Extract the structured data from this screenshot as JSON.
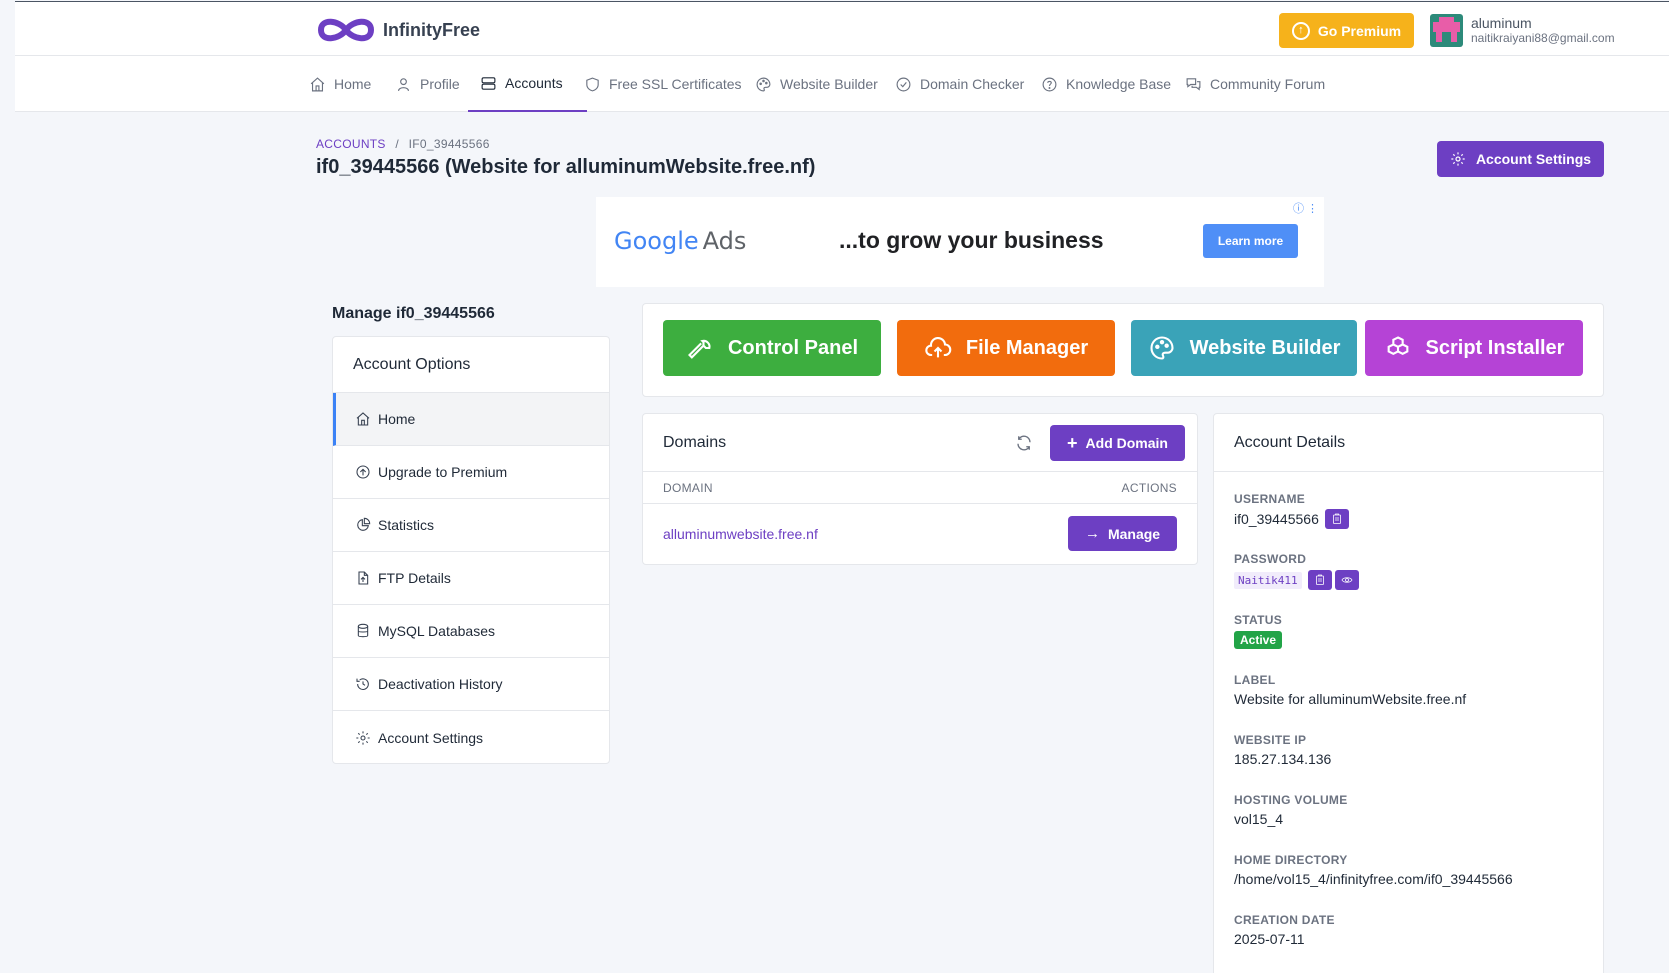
{
  "header": {
    "brand": "InfinityFree",
    "premium_label": "Go Premium",
    "user_name": "aluminum",
    "user_email": "naitikraiyani88@gmail.com"
  },
  "nav": {
    "items": [
      {
        "label": "Home",
        "icon": "home-icon"
      },
      {
        "label": "Profile",
        "icon": "user-icon"
      },
      {
        "label": "Accounts",
        "icon": "server-icon",
        "active": true
      },
      {
        "label": "Free SSL Certificates",
        "icon": "shield-icon"
      },
      {
        "label": "Website Builder",
        "icon": "palette-icon"
      },
      {
        "label": "Domain Checker",
        "icon": "check-circle-icon"
      },
      {
        "label": "Knowledge Base",
        "icon": "help-circle-icon"
      },
      {
        "label": "Community Forum",
        "icon": "chat-icon"
      }
    ]
  },
  "breadcrumb": {
    "root": "ACCOUNTS",
    "sep": "/",
    "current": "IF0_39445566"
  },
  "page": {
    "title": "if0_39445566 (Website for alluminumWebsite.free.nf)",
    "settings_button": "Account Settings"
  },
  "ad": {
    "brand_google": "Google",
    "brand_ads": "Ads",
    "headline": "...to grow your business",
    "cta": "Learn more"
  },
  "sidebar": {
    "manage_title": "Manage if0_39445566",
    "heading": "Account Options",
    "items": [
      {
        "label": "Home",
        "icon": "home-icon"
      },
      {
        "label": "Upgrade to Premium",
        "icon": "upgrade-icon"
      },
      {
        "label": "Statistics",
        "icon": "pie-chart-icon"
      },
      {
        "label": "FTP Details",
        "icon": "file-upload-icon"
      },
      {
        "label": "MySQL Databases",
        "icon": "database-icon"
      },
      {
        "label": "Deactivation History",
        "icon": "history-icon"
      },
      {
        "label": "Account Settings",
        "icon": "gear-icon"
      }
    ]
  },
  "tools": {
    "control_panel": "Control Panel",
    "file_manager": "File Manager",
    "website_builder": "Website Builder",
    "script_installer": "Script Installer",
    "colors": {
      "control_panel": "#3dae3f",
      "file_manager": "#f26c0d",
      "website_builder": "#3aa3b8",
      "script_installer": "#b543d6"
    }
  },
  "domains": {
    "title": "Domains",
    "add_button": "Add Domain",
    "col_domain": "DOMAIN",
    "col_actions": "ACTIONS",
    "rows": [
      {
        "domain": "alluminumwebsite.free.nf",
        "action": "Manage"
      }
    ]
  },
  "details": {
    "title": "Account Details",
    "username_label": "USERNAME",
    "username": "if0_39445566",
    "password_label": "PASSWORD",
    "password": "Naitik411",
    "status_label": "STATUS",
    "status": "Active",
    "label_label": "LABEL",
    "label": "Website for alluminumWebsite.free.nf",
    "ip_label": "WEBSITE IP",
    "ip": "185.27.134.136",
    "volume_label": "HOSTING VOLUME",
    "volume": "vol15_4",
    "homedir_label": "HOME DIRECTORY",
    "homedir": "/home/vol15_4/infinityfree.com/if0_39445566",
    "created_label": "CREATION DATE",
    "created": "2025-07-11"
  },
  "colors": {
    "accent": "#6d3fc3",
    "premium": "#f6b21b",
    "status_active": "#22a447"
  }
}
